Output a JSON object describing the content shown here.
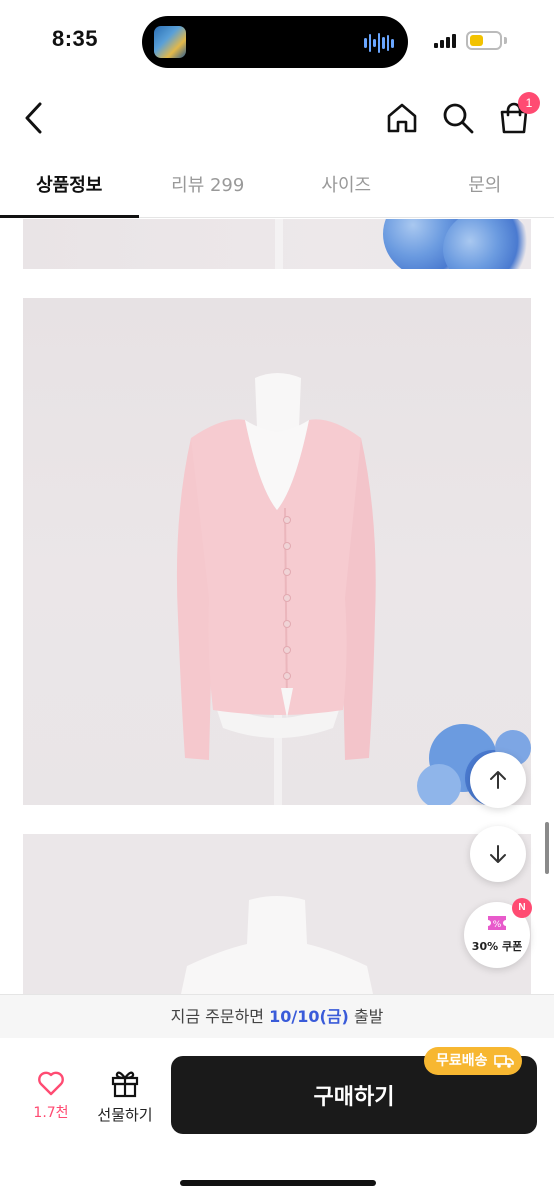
{
  "status_bar": {
    "time": "8:35",
    "battery_level": 0.45,
    "battery_color": "#f2c200"
  },
  "top_nav": {
    "back_icon": "chevron-left-icon",
    "home_icon": "home-icon",
    "search_icon": "search-icon",
    "cart_icon": "shopping-bag-icon",
    "cart_count": "1"
  },
  "tabs": [
    {
      "label": "상품정보",
      "active": true
    },
    {
      "label": "리뷰 299",
      "active": false
    },
    {
      "label": "사이즈",
      "active": false
    },
    {
      "label": "문의",
      "active": false
    }
  ],
  "floating": {
    "scroll_up_icon": "arrow-up-icon",
    "scroll_down_icon": "arrow-down-icon",
    "coupon_label": "30% 쿠폰",
    "coupon_badge": "N"
  },
  "shipping": {
    "prefix": "지금 주문하면",
    "date": "10/10(금)",
    "suffix": "출발"
  },
  "actions": {
    "like_count": "1.7천",
    "gift_label": "선물하기",
    "buy_label": "구매하기",
    "free_shipping_label": "무료배송"
  },
  "colors": {
    "accent_pink": "#ff4b72",
    "date_blue": "#3a5bd9",
    "free_ship_orange": "#f7b731",
    "cardigan_pink": "#f6c9cf"
  }
}
